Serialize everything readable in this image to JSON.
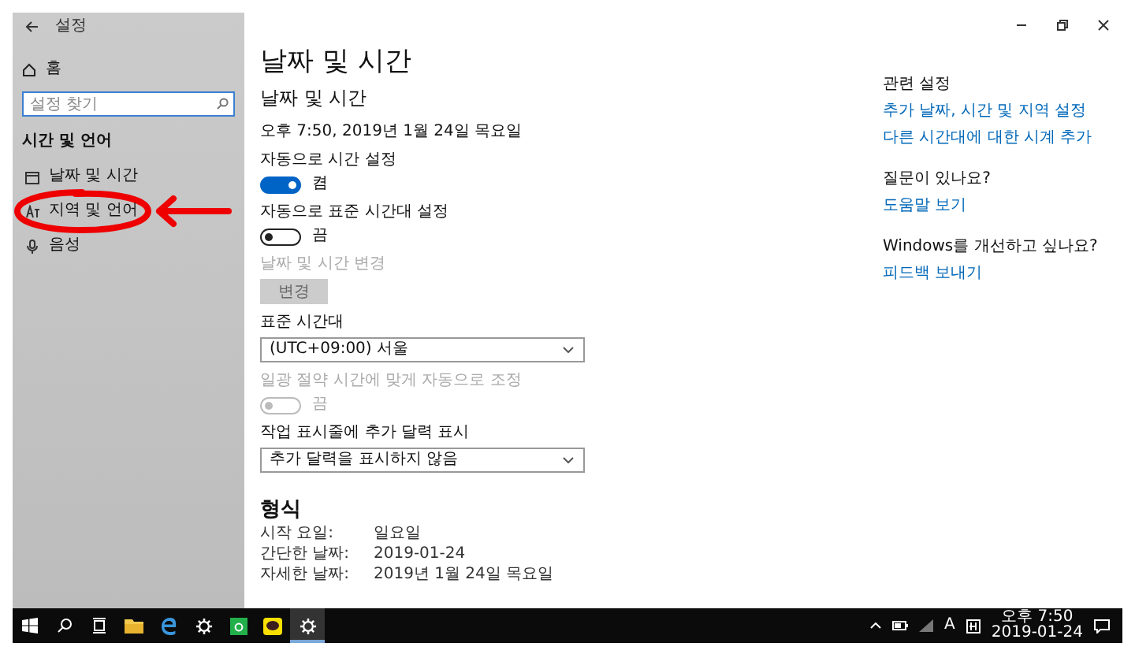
{
  "window": {
    "title": "설정"
  },
  "sidebar": {
    "home": "홈",
    "search": {
      "placeholder": "설정 찾기"
    },
    "section": "시간 및 언어",
    "items": [
      {
        "label": "날짜 및 시간",
        "kind": "calendar"
      },
      {
        "label": "지역 및 언어",
        "kind": "language"
      },
      {
        "label": "음성",
        "kind": "mic"
      }
    ]
  },
  "main": {
    "title": "날짜 및 시간",
    "subtitle": "날짜 및 시간",
    "current": "오후 7:50, 2019년 1월 24일 목요일",
    "settings": [
      {
        "kind": "toggle",
        "label": "자동으로 시간 설정",
        "on": true,
        "disabled": false,
        "state_text": "켬"
      },
      {
        "kind": "toggle",
        "label": "자동으로 표준 시간대 설정",
        "on": false,
        "disabled": false,
        "state_text": "끔"
      },
      {
        "kind": "button",
        "label": "날짜 및 시간 변경",
        "button": "변경",
        "disabled": true
      },
      {
        "kind": "dropdown",
        "label": "표준 시간대",
        "value": "(UTC+09:00) 서울"
      },
      {
        "kind": "toggle",
        "label": "일광 절약 시간에 맞게 자동으로 조정",
        "on": false,
        "disabled": true,
        "state_text": "끔"
      },
      {
        "kind": "dropdown",
        "label": "작업 표시줄에 추가 달력 표시",
        "value": "추가 달력을 표시하지 않음"
      }
    ],
    "format": {
      "heading": "형식",
      "rows": [
        {
          "label": "시작 요일:",
          "value": "일요일"
        },
        {
          "label": "간단한 날짜:",
          "value": "2019-01-24"
        },
        {
          "label": "자세한 날짜:",
          "value": "2019년 1월 24일 목요일"
        }
      ]
    }
  },
  "related": [
    {
      "heading": "관련 설정",
      "links": [
        "추가 날짜, 시간 및 지역 설정",
        "다른 시간대에 대한 시계 추가"
      ]
    },
    {
      "heading": "질문이 있나요?",
      "links": [
        "도움말 보기"
      ]
    },
    {
      "heading": "Windows를 개선하고 싶나요?",
      "links": [
        "피드백 보내기"
      ]
    }
  ],
  "taskbar": {
    "apps": [
      {
        "kind": "start",
        "selected": false
      },
      {
        "kind": "search",
        "selected": false
      },
      {
        "kind": "taskview",
        "selected": false
      },
      {
        "kind": "folder",
        "selected": false
      },
      {
        "kind": "browser",
        "selected": false
      },
      {
        "kind": "gear-outline",
        "selected": false
      },
      {
        "kind": "green-app",
        "selected": false
      },
      {
        "kind": "chat",
        "selected": false
      },
      {
        "kind": "gear",
        "selected": true
      }
    ],
    "tray": [
      {
        "kind": "chevron"
      },
      {
        "kind": "battery"
      },
      {
        "kind": "wifi"
      },
      {
        "kind": "text",
        "text": "A"
      },
      {
        "kind": "ime"
      }
    ],
    "time": "오후 7:50",
    "date": "2019-01-24"
  }
}
